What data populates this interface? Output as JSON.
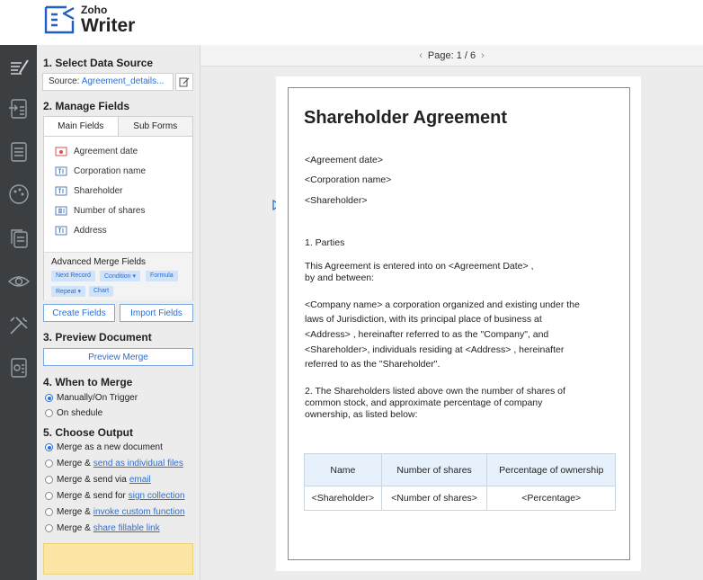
{
  "app": {
    "brand_top": "Zoho",
    "brand_name": "Writer"
  },
  "rail": {
    "icons": [
      "compose-icon",
      "import-icon",
      "document-icon",
      "theme-icon",
      "copy-icon",
      "preview-icon",
      "tools-icon",
      "settings-icon"
    ]
  },
  "panel": {
    "step1_title": "1. Select Data Source",
    "source_label": "Source:",
    "source_value": "Agreement_details...",
    "step2_title": "2. Manage Fields",
    "tabs": [
      "Main Fields",
      "Sub Forms"
    ],
    "fields": [
      "Agreement date",
      "Corporation name",
      "Shareholder",
      "Number of shares",
      "Address"
    ],
    "advanced_title": "Advanced Merge Fields",
    "advanced_chips": [
      "Next Record",
      "Condition ▾",
      "Formula",
      "Repeat ▾",
      "Chart"
    ],
    "create_fields": "Create Fields",
    "import_fields": "Import Fields",
    "step3_title": "3. Preview Document",
    "preview_merge": "Preview Merge",
    "step4_title": "4. When to Merge",
    "merge_when": [
      "Manually/On Trigger",
      "On shedule"
    ],
    "step5_title": "5. Choose Output",
    "outputs": [
      {
        "prefix": "Merge as a new document",
        "link": ""
      },
      {
        "prefix": "Merge &",
        "link": "send as individual files"
      },
      {
        "prefix": "Merge & send via",
        "link": "email"
      },
      {
        "prefix": "Merge & send for",
        "link": "sign collection"
      },
      {
        "prefix": "Merge &",
        "link": "invoke custom function"
      },
      {
        "prefix": "Merge &",
        "link": "share fillable link"
      }
    ]
  },
  "main": {
    "page_indicator": "Page: 1 / 6",
    "doc": {
      "title": "Shareholder Agreement",
      "fields": [
        "<Agreement date>",
        "<Corporation name>",
        "<Shareholder>"
      ],
      "section1": "1. Parties",
      "para1_l1": "This Agreement is entered into on <Agreement Date> ,",
      "para1_l2": "by and between:",
      "para2_l1": "<Company name>  a corporation organized and existing under the",
      "para2_l2": "laws of Jurisdiction, with its principal place of business at",
      "para2_l3": "<Address> , hereinafter referred to as the \"Company\", and",
      "para2_l4": "<Shareholder>, individuals residing at <Address> , hereinafter",
      "para2_l5": "referred to as the \"Shareholder\".",
      "para3_l1": "2. The Shareholders listed above own the number of shares of",
      "para3_l2": "common stock, and approximate percentage of company",
      "para3_l3": "ownership, as listed below:",
      "table_headers": [
        "Name",
        "Number of shares",
        "Percentage of ownership"
      ],
      "table_row": [
        "<Shareholder>",
        "<Number of shares>",
        "<Percentage>"
      ]
    }
  }
}
